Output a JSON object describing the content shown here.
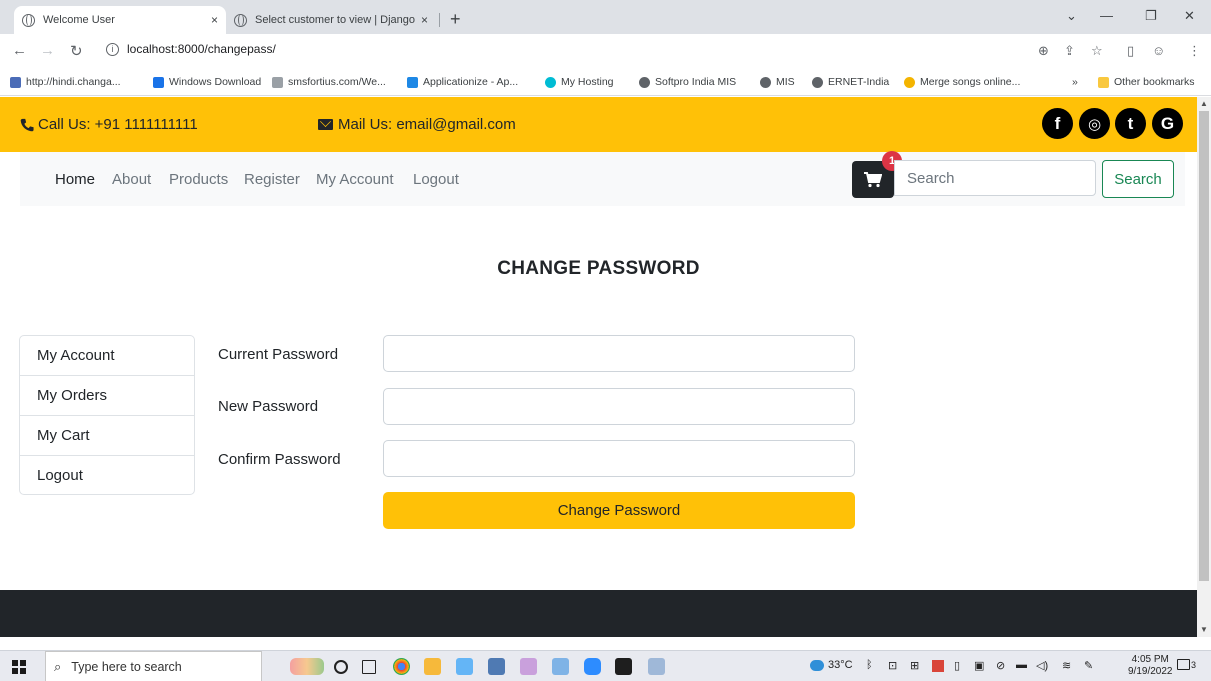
{
  "browser": {
    "tabs": [
      {
        "title": "Welcome User",
        "close": "×"
      },
      {
        "title": "Select customer to view | Django",
        "close": "×"
      }
    ],
    "new_tab": "+",
    "url": "localhost:8000/changepass/",
    "bookmarks": [
      {
        "label": "http://hindi.changa...",
        "color": "#4b6cb7"
      },
      {
        "label": "Windows Download",
        "color": "#1a73e8"
      },
      {
        "label": "smsfortius.com/We...",
        "color": "#9aa0a6"
      },
      {
        "label": "Applicationize - Ap...",
        "color": "#1e88e5"
      },
      {
        "label": "My Hosting",
        "color": "#00bcd4"
      },
      {
        "label": "Softpro India MIS",
        "color": "#5f6368"
      },
      {
        "label": "MIS",
        "color": "#5f6368"
      },
      {
        "label": "ERNET-India",
        "color": "#5f6368"
      },
      {
        "label": "Merge songs online...",
        "color": "#f4b400"
      }
    ],
    "bookmarks_overflow": "»",
    "other_bookmarks": "Other bookmarks"
  },
  "contact": {
    "call": "Call Us: +91 1111111111",
    "mail": "Mail Us: email@gmail.com"
  },
  "social": [
    "f",
    "◎",
    "t",
    "G"
  ],
  "nav": {
    "links": [
      "Home",
      "About",
      "Products",
      "Register",
      "My Account",
      "Logout"
    ],
    "cart_count": "1",
    "search_placeholder": "Search",
    "search_button": "Search"
  },
  "page_title": "CHANGE PASSWORD",
  "side_menu": [
    "My Account",
    "My Orders",
    "My Cart",
    "Logout"
  ],
  "form": {
    "current_label": "Current Password",
    "new_label": "New Password",
    "confirm_label": "Confirm Password",
    "submit": "Change Password"
  },
  "taskbar": {
    "search_placeholder": "Type here to search",
    "weather": "33°C",
    "time": "4:05 PM",
    "date": "9/19/2022",
    "notifications": "3"
  },
  "colors": {
    "primary": "#ffc107",
    "dark": "#212529",
    "success": "#198754",
    "danger": "#dc3545"
  }
}
